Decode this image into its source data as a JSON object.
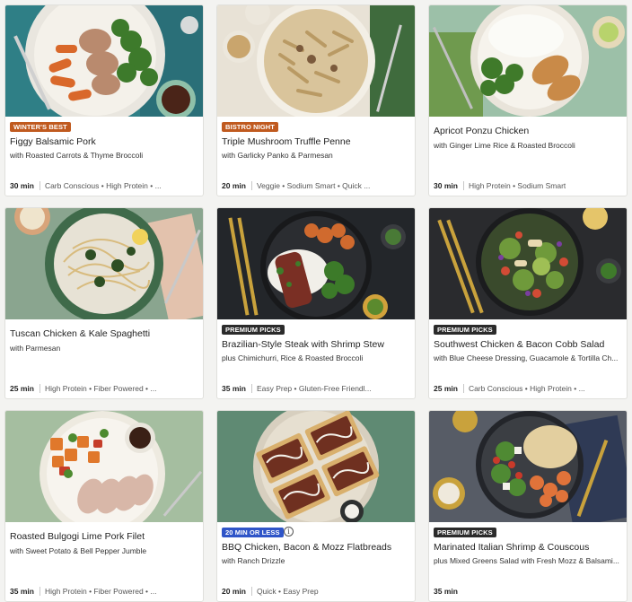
{
  "colors": {
    "badge_orange": "#c05a1f",
    "badge_dark": "#2b2b2b",
    "badge_blue": "#2f55c8"
  },
  "cards": [
    {
      "badge": "WINTER'S BEST",
      "badge_color": "#c05a1f",
      "title": "Figgy Balsamic Pork",
      "subtitle": "with Roasted Carrots & Thyme Broccoli",
      "time": "30 min",
      "tags": "Carb Conscious • High Protein • ..."
    },
    {
      "badge": "BISTRO NIGHT",
      "badge_color": "#c05a1f",
      "title": "Triple Mushroom Truffle Penne",
      "subtitle": "with Garlicky Panko & Parmesan",
      "time": "20 min",
      "tags": "Veggie • Sodium Smart • Quick ..."
    },
    {
      "title": "Apricot Ponzu Chicken",
      "subtitle": "with Ginger Lime Rice & Roasted Broccoli",
      "time": "30 min",
      "tags": "High Protein • Sodium Smart"
    },
    {
      "title": "Tuscan Chicken & Kale Spaghetti",
      "subtitle": "with Parmesan",
      "time": "25 min",
      "tags": "High Protein • Fiber Powered • ..."
    },
    {
      "badge": "PREMIUM PICKS",
      "badge_color": "#2b2b2b",
      "title": "Brazilian-Style Steak with Shrimp Stew",
      "subtitle": "plus Chimichurri, Rice & Roasted Broccoli",
      "time": "35 min",
      "tags": "Easy Prep • Gluten-Free Friendl..."
    },
    {
      "badge": "PREMIUM PICKS",
      "badge_color": "#2b2b2b",
      "title": "Southwest Chicken & Bacon Cobb Salad",
      "subtitle": "with Blue Cheese Dressing, Guacamole & Tortilla Ch...",
      "time": "25 min",
      "tags": "Carb Conscious • High Protein • ..."
    },
    {
      "title": "Roasted Bulgogi Lime Pork Filet",
      "subtitle": "with Sweet Potato & Bell Pepper Jumble",
      "time": "35 min",
      "tags": "High Protein • Fiber Powered • ..."
    },
    {
      "badge": "20 MIN OR LESS",
      "badge_color": "#2f55c8",
      "info_icon": "i",
      "title": "BBQ Chicken, Bacon & Mozz Flatbreads",
      "subtitle": "with Ranch Drizzle",
      "time": "20 min",
      "tags": "Quick • Easy Prep"
    },
    {
      "badge": "PREMIUM PICKS",
      "badge_color": "#2b2b2b",
      "title": "Marinated Italian Shrimp & Couscous",
      "subtitle": "plus Mixed Greens Salad with Fresh Mozz & Balsami...",
      "time": "35 min",
      "tags": ""
    }
  ]
}
